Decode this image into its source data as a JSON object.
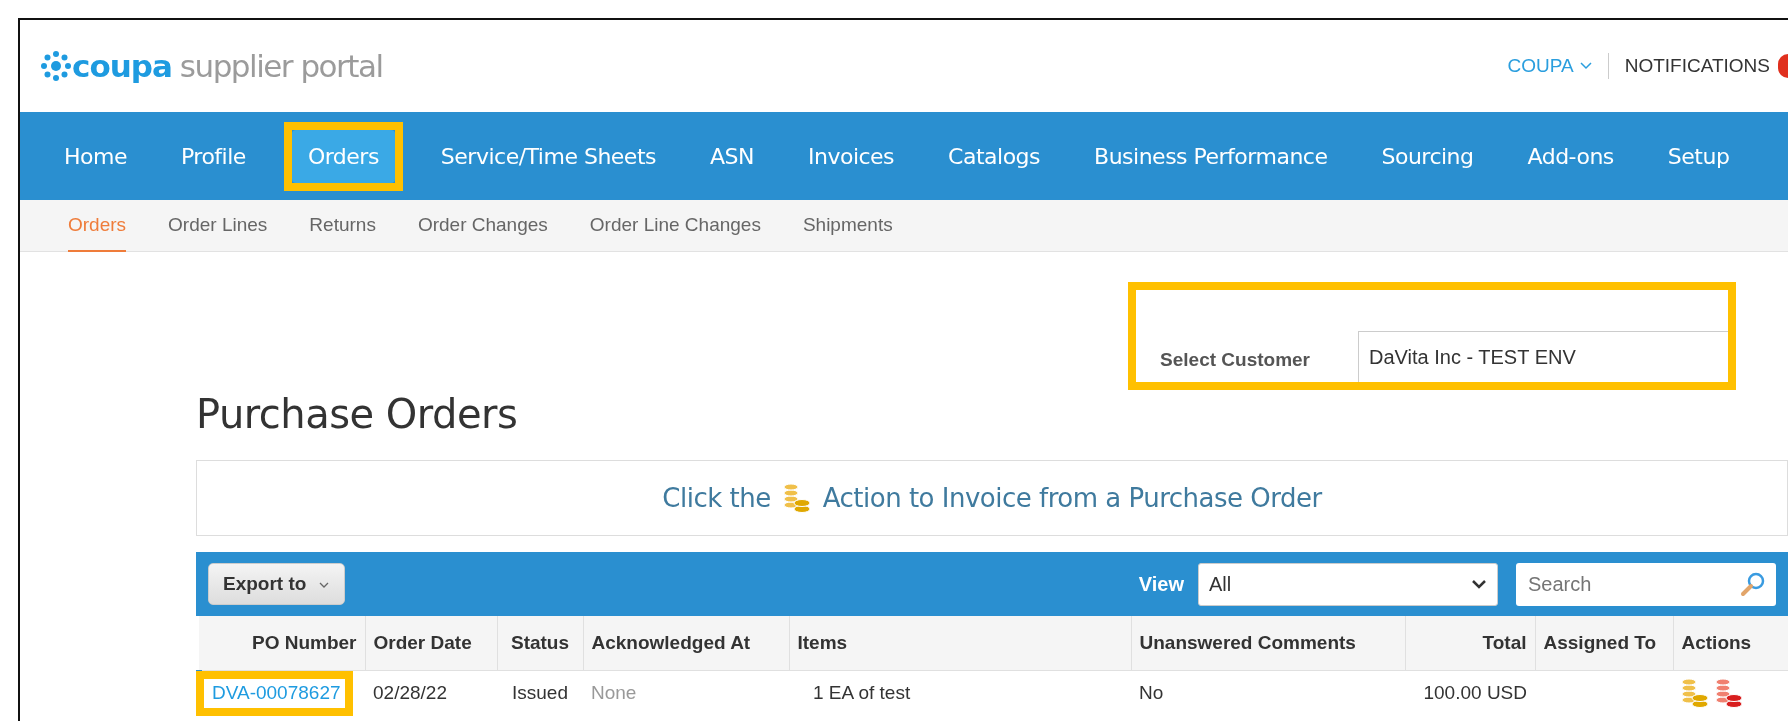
{
  "header": {
    "brand": "coupa",
    "tagline": "supplier portal",
    "account_menu": "COUPA",
    "notifications": "NOTIFICATIONS"
  },
  "nav": [
    {
      "label": "Home",
      "selected": false,
      "highlighted": false
    },
    {
      "label": "Profile",
      "selected": false,
      "highlighted": false
    },
    {
      "label": "Orders",
      "selected": true,
      "highlighted": true
    },
    {
      "label": "Service/Time Sheets",
      "selected": false,
      "highlighted": false
    },
    {
      "label": "ASN",
      "selected": false,
      "highlighted": false
    },
    {
      "label": "Invoices",
      "selected": false,
      "highlighted": false
    },
    {
      "label": "Catalogs",
      "selected": false,
      "highlighted": false
    },
    {
      "label": "Business Performance",
      "selected": false,
      "highlighted": false
    },
    {
      "label": "Sourcing",
      "selected": false,
      "highlighted": false
    },
    {
      "label": "Add-ons",
      "selected": false,
      "highlighted": false
    },
    {
      "label": "Setup",
      "selected": false,
      "highlighted": false
    }
  ],
  "subnav": [
    {
      "label": "Orders",
      "selected": true
    },
    {
      "label": "Order Lines",
      "selected": false
    },
    {
      "label": "Returns",
      "selected": false
    },
    {
      "label": "Order Changes",
      "selected": false
    },
    {
      "label": "Order Line Changes",
      "selected": false
    },
    {
      "label": "Shipments",
      "selected": false
    }
  ],
  "customer_select": {
    "label": "Select Customer",
    "value": "DaVita Inc - TEST ENV",
    "highlighted": true
  },
  "page_title": "Purchase Orders",
  "banner": {
    "before": "Click the",
    "after": "Action to Invoice from a Purchase Order"
  },
  "toolbar": {
    "export_button": "Export to",
    "view_label": "View",
    "view_value": "All",
    "search_placeholder": "Search"
  },
  "table": {
    "columns": [
      "PO Number",
      "Order Date",
      "Status",
      "Acknowledged At",
      "Items",
      "Unanswered Comments",
      "Total",
      "Assigned To",
      "Actions"
    ],
    "rows": [
      {
        "po_number": "DVA-00078627",
        "highlighted": true,
        "order_date": "02/28/22",
        "status": "Issued",
        "acknowledged_at": "None",
        "items": "1 EA of test",
        "unanswered_comments": "No",
        "total": "100.00 USD"
      }
    ]
  }
}
